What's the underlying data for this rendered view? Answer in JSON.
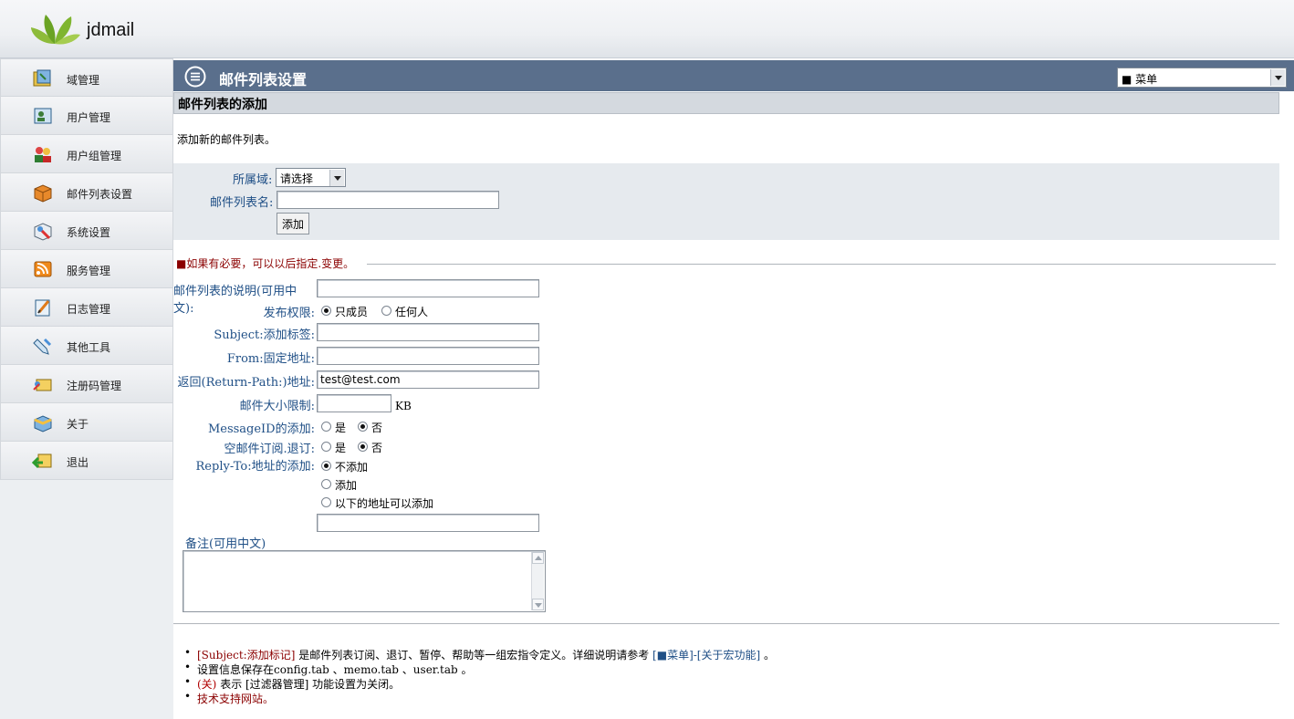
{
  "app": {
    "name": "jdmail"
  },
  "sidebar": {
    "items": [
      {
        "label": "域管理",
        "icon": "domain-icon"
      },
      {
        "label": "用户管理",
        "icon": "user-icon"
      },
      {
        "label": "用户组管理",
        "icon": "user-group-icon"
      },
      {
        "label": "邮件列表设置",
        "icon": "mailing-list-icon"
      },
      {
        "label": "系统设置",
        "icon": "system-settings-icon"
      },
      {
        "label": "服务管理",
        "icon": "service-icon"
      },
      {
        "label": "日志管理",
        "icon": "log-icon"
      },
      {
        "label": "其他工具",
        "icon": "tools-icon"
      },
      {
        "label": "注册码管理",
        "icon": "license-icon"
      },
      {
        "label": "关于",
        "icon": "about-icon"
      },
      {
        "label": "退出",
        "icon": "logout-icon"
      }
    ]
  },
  "header": {
    "title": "邮件列表设置",
    "menu_selected": "■ 菜单"
  },
  "section": {
    "title": "邮件列表的添加",
    "description": "添加新的邮件列表。"
  },
  "basic_form": {
    "domain_label": "所属域:",
    "domain_selected": "请选择",
    "list_name_label": "邮件列表名:",
    "list_name_value": "",
    "add_button": "添加"
  },
  "optional": {
    "note": "■如果有必要，可以以后指定.变更。",
    "description_label": "邮件列表的说明(可用中文):",
    "description_value": "",
    "publish_label": "发布权限:",
    "publish_options": [
      "只成员",
      "任何人"
    ],
    "publish_selected": 0,
    "subject_tag_label": "Subject:添加标签:",
    "subject_tag_value": "",
    "from_label": "From:固定地址:",
    "from_value": "",
    "return_path_label": "返回(Return-Path:)地址:",
    "return_path_value": "test@test.com",
    "size_limit_label": "邮件大小限制:",
    "size_limit_value": "",
    "size_unit": "KB",
    "messageid_label": "MessageID的添加:",
    "messageid_options": [
      "是",
      "否"
    ],
    "messageid_selected": 1,
    "empty_subscribe_label": "空邮件订阅.退订:",
    "empty_subscribe_options": [
      "是",
      "否"
    ],
    "empty_subscribe_selected": 1,
    "reply_to_label": "Reply-To:地址的添加:",
    "reply_to_options": [
      "不添加",
      "添加",
      "以下的地址可以添加"
    ],
    "reply_to_selected": 0,
    "reply_to_address": "",
    "memo_label": "备注(可用中文)",
    "memo_value": ""
  },
  "notes": {
    "n1_link": "[Subject:添加标记]",
    "n1_text": " 是邮件列表订阅、退订、暂停、帮助等一组宏指令定义。详细说明请参考 ",
    "n1_ref": "[■菜单]-[关于宏功能]",
    "n1_end": " 。",
    "n2": "设置信息保存在config.tab 、memo.tab 、user.tab 。",
    "n3_red": "(关)",
    "n3_text": " 表示  [过滤器管理] 功能设置为关闭。",
    "n4_link": "技术支持网站。"
  }
}
